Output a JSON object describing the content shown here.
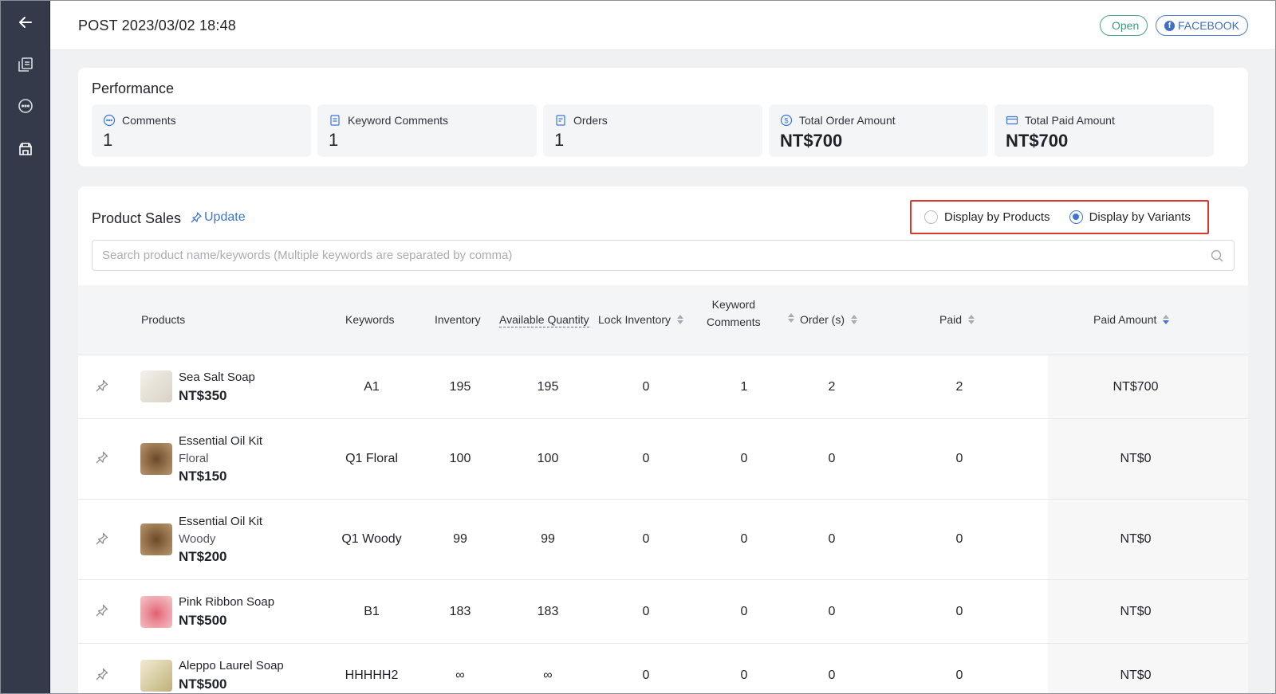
{
  "header": {
    "post_title": "POST 2023/03/02 18:48",
    "status_label": "Open",
    "platform_label": "FACEBOOK"
  },
  "sidebar": {
    "items": [
      "back-arrow-icon",
      "posts-icon",
      "comments-icon",
      "store-icon"
    ]
  },
  "performance": {
    "title": "Performance",
    "stats": [
      {
        "label": "Comments",
        "value": "1",
        "icon": "comment-icon"
      },
      {
        "label": "Keyword Comments",
        "value": "1",
        "icon": "keyword-doc-icon"
      },
      {
        "label": "Orders",
        "value": "1",
        "icon": "order-doc-icon"
      },
      {
        "label": "Total Order Amount",
        "value": "NT$700",
        "icon": "dollar-circle-icon"
      },
      {
        "label": "Total Paid Amount",
        "value": "NT$700",
        "icon": "card-icon"
      }
    ]
  },
  "product_sales": {
    "title": "Product Sales",
    "update_label": "Update",
    "display_options": [
      {
        "label": "Display by Products",
        "selected": false
      },
      {
        "label": "Display by Variants",
        "selected": true
      }
    ],
    "search_placeholder": "Search product name/keywords (Multiple keywords are separated by comma)",
    "columns": {
      "products": "Products",
      "keywords": "Keywords",
      "inventory": "Inventory",
      "available": "Available Quantity",
      "lock": "Lock Inventory",
      "keyword_comments_line1": "Keyword",
      "keyword_comments_line2": "Comments",
      "orders": "Order (s)",
      "paid": "Paid",
      "paid_amount": "Paid Amount"
    },
    "rows": [
      {
        "name": "Sea Salt Soap",
        "variant": "",
        "price": "NT$350",
        "keyword": "A1",
        "inventory": "195",
        "available": "195",
        "lock": "0",
        "keyword_comments": "1",
        "orders": "2",
        "paid": "2",
        "paid_amount": "NT$700"
      },
      {
        "name": "Essential Oil Kit",
        "variant": "Floral",
        "price": "NT$150",
        "keyword": "Q1 Floral",
        "inventory": "100",
        "available": "100",
        "lock": "0",
        "keyword_comments": "0",
        "orders": "0",
        "paid": "0",
        "paid_amount": "NT$0"
      },
      {
        "name": "Essential Oil Kit",
        "variant": "Woody",
        "price": "NT$200",
        "keyword": "Q1 Woody",
        "inventory": "99",
        "available": "99",
        "lock": "0",
        "keyword_comments": "0",
        "orders": "0",
        "paid": "0",
        "paid_amount": "NT$0"
      },
      {
        "name": "Pink Ribbon Soap",
        "variant": "",
        "price": "NT$500",
        "keyword": "B1",
        "inventory": "183",
        "available": "183",
        "lock": "0",
        "keyword_comments": "0",
        "orders": "0",
        "paid": "0",
        "paid_amount": "NT$0"
      },
      {
        "name": "Aleppo Laurel Soap",
        "variant": "",
        "price": "NT$500",
        "keyword": "HHHHH2",
        "inventory": "∞",
        "available": "∞",
        "lock": "0",
        "keyword_comments": "0",
        "orders": "0",
        "paid": "0",
        "paid_amount": "NT$0"
      }
    ]
  },
  "colors": {
    "sidebar_bg": "#343a4a",
    "accent_blue": "#3d76d6",
    "open_green": "#4aa587",
    "highlight_red": "#d9382e",
    "content_bg": "#f0f1f3"
  }
}
